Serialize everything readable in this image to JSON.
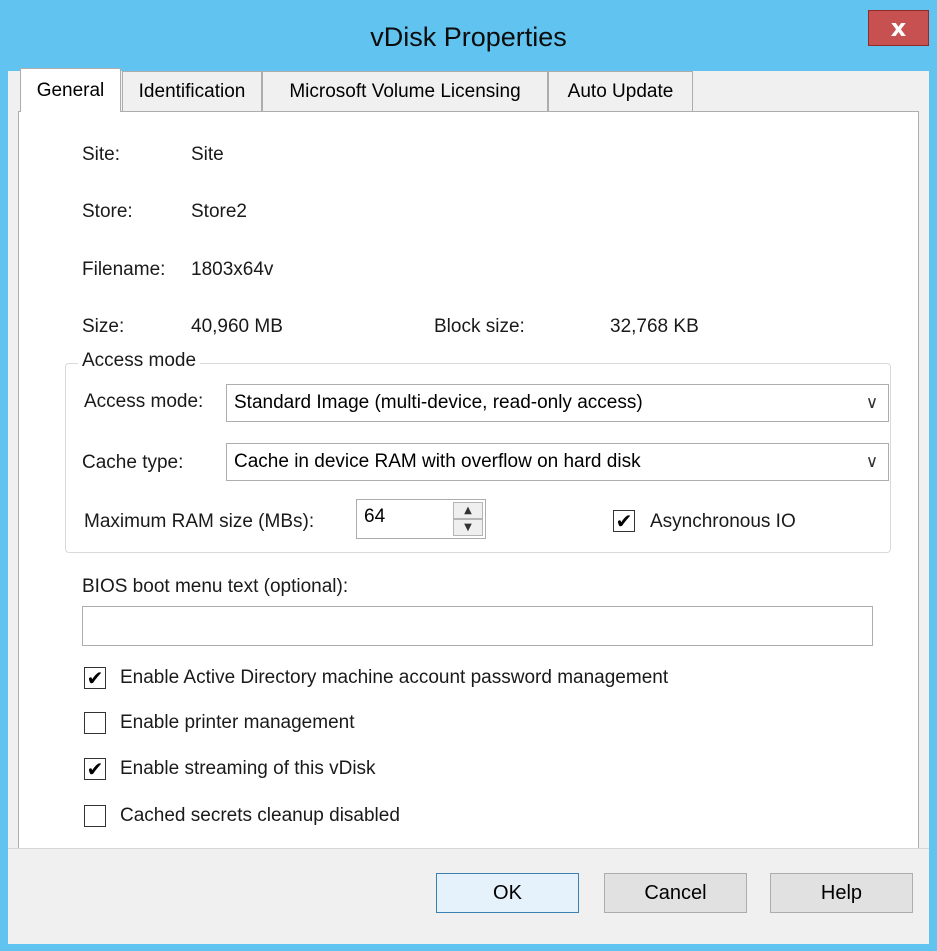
{
  "window": {
    "title": "vDisk Properties",
    "close_label": "x"
  },
  "tabs": [
    {
      "label": "General",
      "active": true
    },
    {
      "label": "Identification",
      "active": false
    },
    {
      "label": "Microsoft Volume Licensing",
      "active": false
    },
    {
      "label": "Auto Update",
      "active": false
    }
  ],
  "info": {
    "site_label": "Site:",
    "site_value": "Site",
    "store_label": "Store:",
    "store_value": "Store2",
    "filename_label": "Filename:",
    "filename_value": "1803x64v",
    "size_label": "Size:",
    "size_value": "40,960 MB",
    "block_size_label": "Block size:",
    "block_size_value": "32,768 KB"
  },
  "access_group": {
    "legend": "Access mode",
    "access_mode_label": "Access mode:",
    "access_mode_value": "Standard Image (multi-device, read-only access)",
    "cache_type_label": "Cache type:",
    "cache_type_value": "Cache in device RAM with overflow on hard disk",
    "max_ram_label": "Maximum RAM size (MBs):",
    "max_ram_value": "64",
    "async_io_label": "Asynchronous IO",
    "async_io_checked": true
  },
  "bios": {
    "label": "BIOS boot menu text (optional):",
    "value": ""
  },
  "options": [
    {
      "label": "Enable Active Directory machine account password management",
      "checked": true
    },
    {
      "label": "Enable printer management",
      "checked": false
    },
    {
      "label": "Enable streaming of this vDisk",
      "checked": true
    },
    {
      "label": "Cached secrets cleanup disabled",
      "checked": false
    }
  ],
  "buttons": {
    "ok": "OK",
    "cancel": "Cancel",
    "help": "Help"
  },
  "icons": {
    "chevron": "chevron-down-icon",
    "spin_up": "spin-up-icon",
    "spin_down": "spin-down-icon",
    "check": "check-icon"
  }
}
